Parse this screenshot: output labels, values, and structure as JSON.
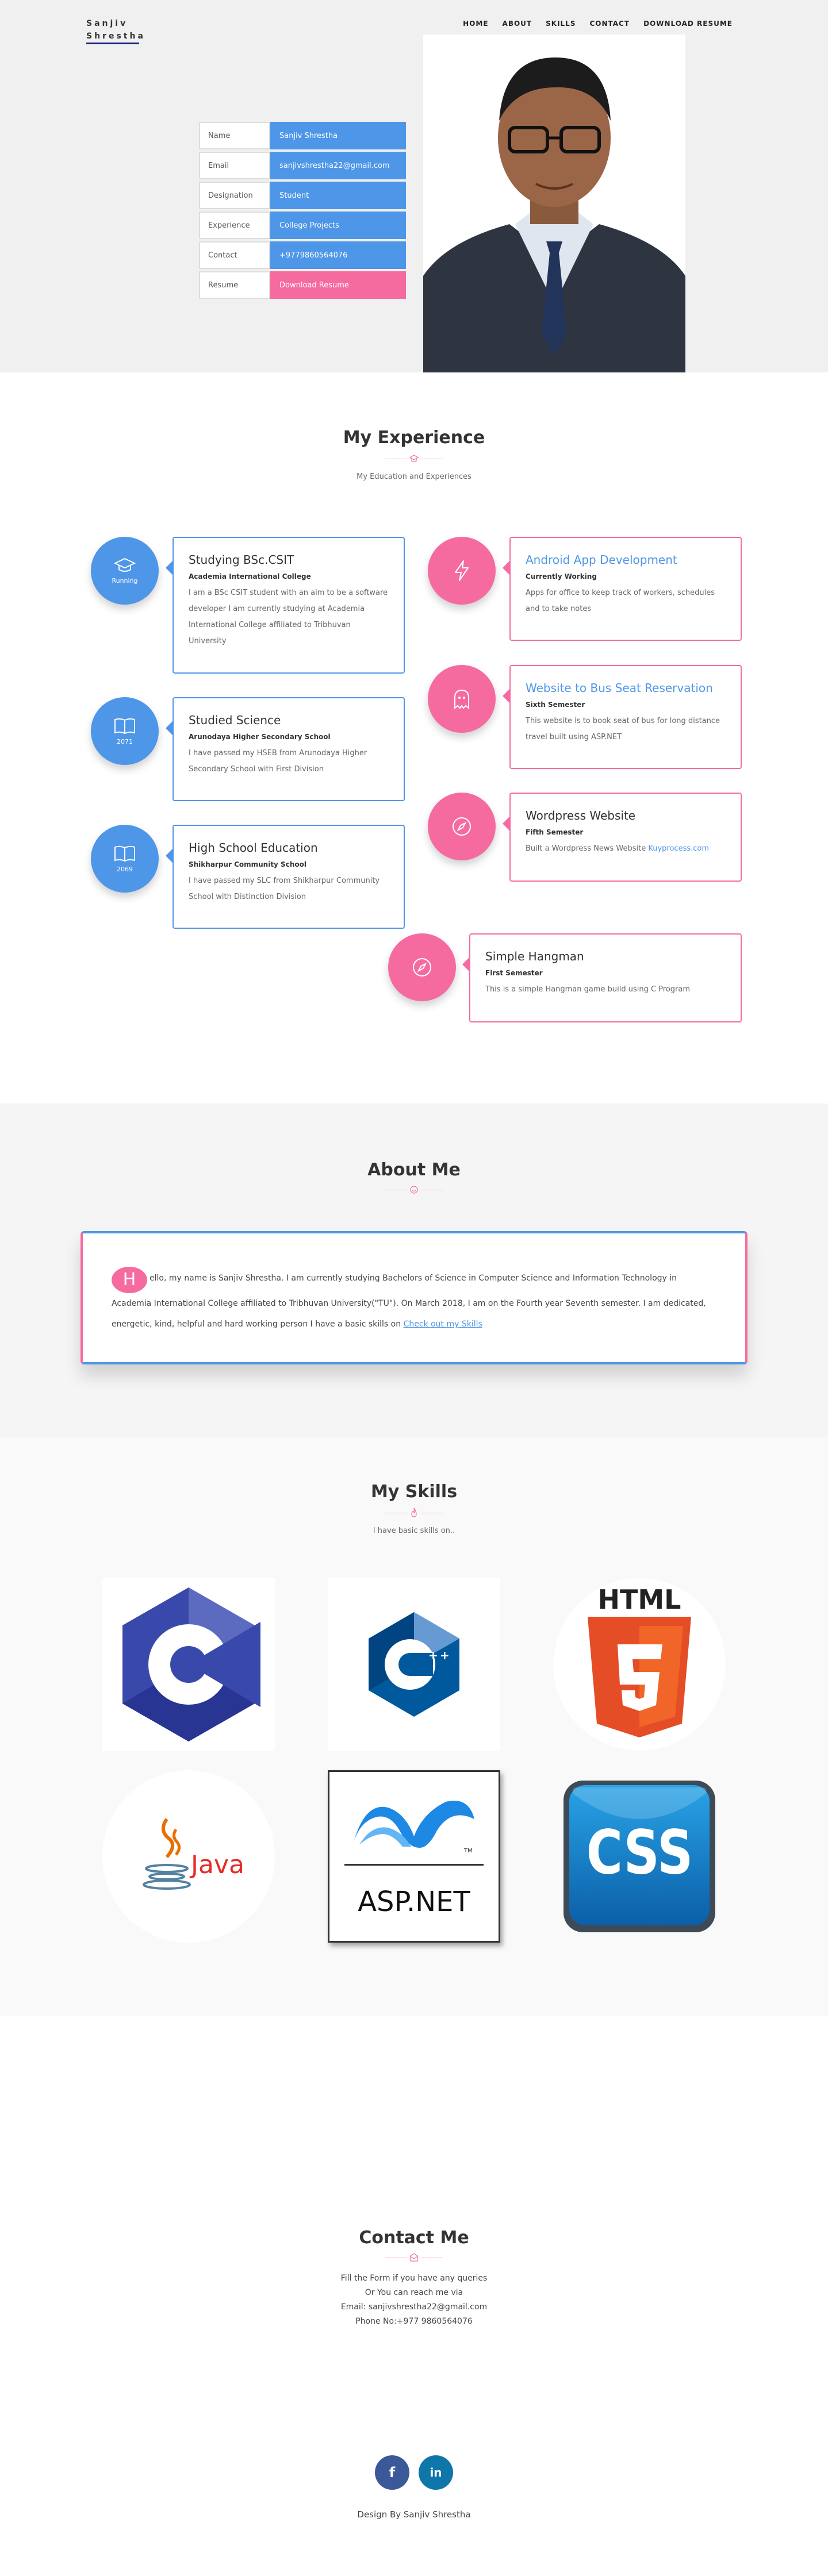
{
  "brand": {
    "line1": "Sanjiv",
    "line2": "Shrestha"
  },
  "nav": [
    "HOME",
    "ABOUT",
    "SKILLS",
    "CONTACT",
    "DOWNLOAD RESUME"
  ],
  "info": [
    {
      "key": "Name",
      "value": "Sanjiv Shrestha"
    },
    {
      "key": "Email",
      "value": "sanjivshrestha22@gmail.com"
    },
    {
      "key": "Designation",
      "value": "Student"
    },
    {
      "key": "Experience",
      "value": "College Projects"
    },
    {
      "key": "Contact",
      "value": "+9779860564076"
    },
    {
      "key": "Resume",
      "value": "Download Resume"
    }
  ],
  "experience": {
    "title": "My Experience",
    "subtitle": "My Education and Experiences",
    "education": [
      {
        "year": "Running",
        "title": "Studying BSc.CSIT",
        "place": "Academia International College",
        "desc": "I am a BSc CSIT student with an aim to be a software developer I am currently studying at Academia International College affiliated to Tribhuvan University"
      },
      {
        "year": "2071",
        "title": "Studied Science",
        "place": "Arunodaya Higher Secondary School",
        "desc": "I have passed my HSEB from Arunodaya Higher Secondary School with First Division"
      },
      {
        "year": "2069",
        "title": "High School Education",
        "place": "Shikharpur Community School",
        "desc": "I have passed my SLC from Shikharpur Community School with Distinction Division"
      }
    ],
    "projects": [
      {
        "title": "Android App Development",
        "sub": "Currently Working",
        "desc": "Apps for office to keep track of workers, schedules and to take notes"
      },
      {
        "title": "Website to Bus Seat Reservation",
        "sub": "Sixth Semester",
        "desc": "This website is to book seat of bus for long distance travel built using ASP.NET"
      },
      {
        "title": "Wordpress Website",
        "sub": "Fifth Semester",
        "desc": "Built a Wordpress News Website",
        "link": "Kuyprocess.com"
      },
      {
        "title": "Simple Hangman",
        "sub": "First Semester",
        "desc": "This is a simple Hangman game build using C Program"
      }
    ]
  },
  "about": {
    "title": "About Me",
    "dropcap": "H",
    "text": "ello, my name is Sanjiv Shrestha. I am currently studying Bachelors of Science in Computer Science and Information Technology in Academia International College affiliated to Tribhuvan University(\"TU\"). On March 2018, I am on the Fourth year Seventh semester. I am dedicated, energetic, kind, helpful and hard working person I have a basic skills on",
    "link": "Check out my Skills"
  },
  "skills": {
    "title": "My Skills",
    "subtitle": "I have basic skills on..",
    "items": [
      {
        "name": "C",
        "icon": "c-logo"
      },
      {
        "name": "C++",
        "icon": "cpp-logo"
      },
      {
        "name": "HTML",
        "icon": "html5-logo"
      },
      {
        "name": "Java",
        "icon": "java-logo"
      },
      {
        "name": "ASP.NET",
        "icon": "aspnet-logo"
      },
      {
        "name": "CSS",
        "icon": "css-logo"
      }
    ]
  },
  "contact": {
    "title": "Contact Me",
    "lines": [
      "Fill the Form if you have any queries",
      "Or You can reach me via",
      "Email: sanjivshrestha22@gmail.com",
      "Phone No:+977 9860564076"
    ]
  },
  "social": [
    {
      "name": "facebook",
      "glyph": "f"
    },
    {
      "name": "linkedin",
      "glyph": "in"
    }
  ],
  "footer": "Design By Sanjiv Shrestha",
  "colors": {
    "blue": "#4e96e8",
    "pink": "#f56ba0",
    "navy": "#1a237e"
  }
}
